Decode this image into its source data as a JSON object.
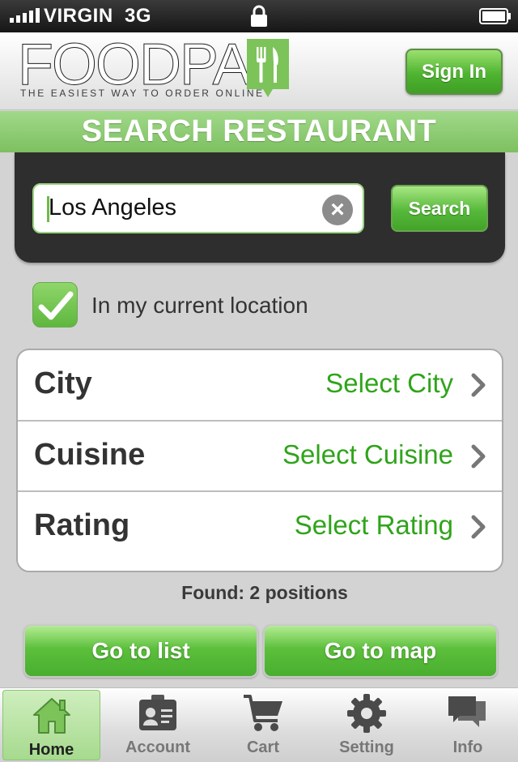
{
  "status_bar": {
    "carrier": "VIRGIN",
    "network": "3G"
  },
  "header": {
    "logo_text": "FOODPAL",
    "tagline": "THE EASIEST WAY TO ORDER ONLINE",
    "sign_in_label": "Sign In"
  },
  "search": {
    "title": "SEARCH  RESTAURANT",
    "input_value": "Los Angeles",
    "button_label": "Search"
  },
  "location_option": {
    "label": "In my current location",
    "checked": true
  },
  "filters": [
    {
      "label": "City",
      "value": "Select  City"
    },
    {
      "label": "Cuisine",
      "value": "Select Cuisine"
    },
    {
      "label": "Rating",
      "value": "Select Rating"
    }
  ],
  "result_summary": "Found: 2 positions",
  "actions": {
    "list_label": "Go to list",
    "map_label": "Go to map"
  },
  "tabs": [
    {
      "label": "Home",
      "icon": "home-icon",
      "active": true
    },
    {
      "label": "Account",
      "icon": "account-card-icon",
      "active": false
    },
    {
      "label": "Cart",
      "icon": "cart-icon",
      "active": false
    },
    {
      "label": "Setting",
      "icon": "gear-icon",
      "active": false
    },
    {
      "label": "Info",
      "icon": "chat-bubble-icon",
      "active": false
    }
  ],
  "colors": {
    "accent_green": "#5cb83c",
    "link_green": "#2fa41a",
    "panel_dark": "#2e2e2e",
    "background": "#d3d3d3"
  }
}
